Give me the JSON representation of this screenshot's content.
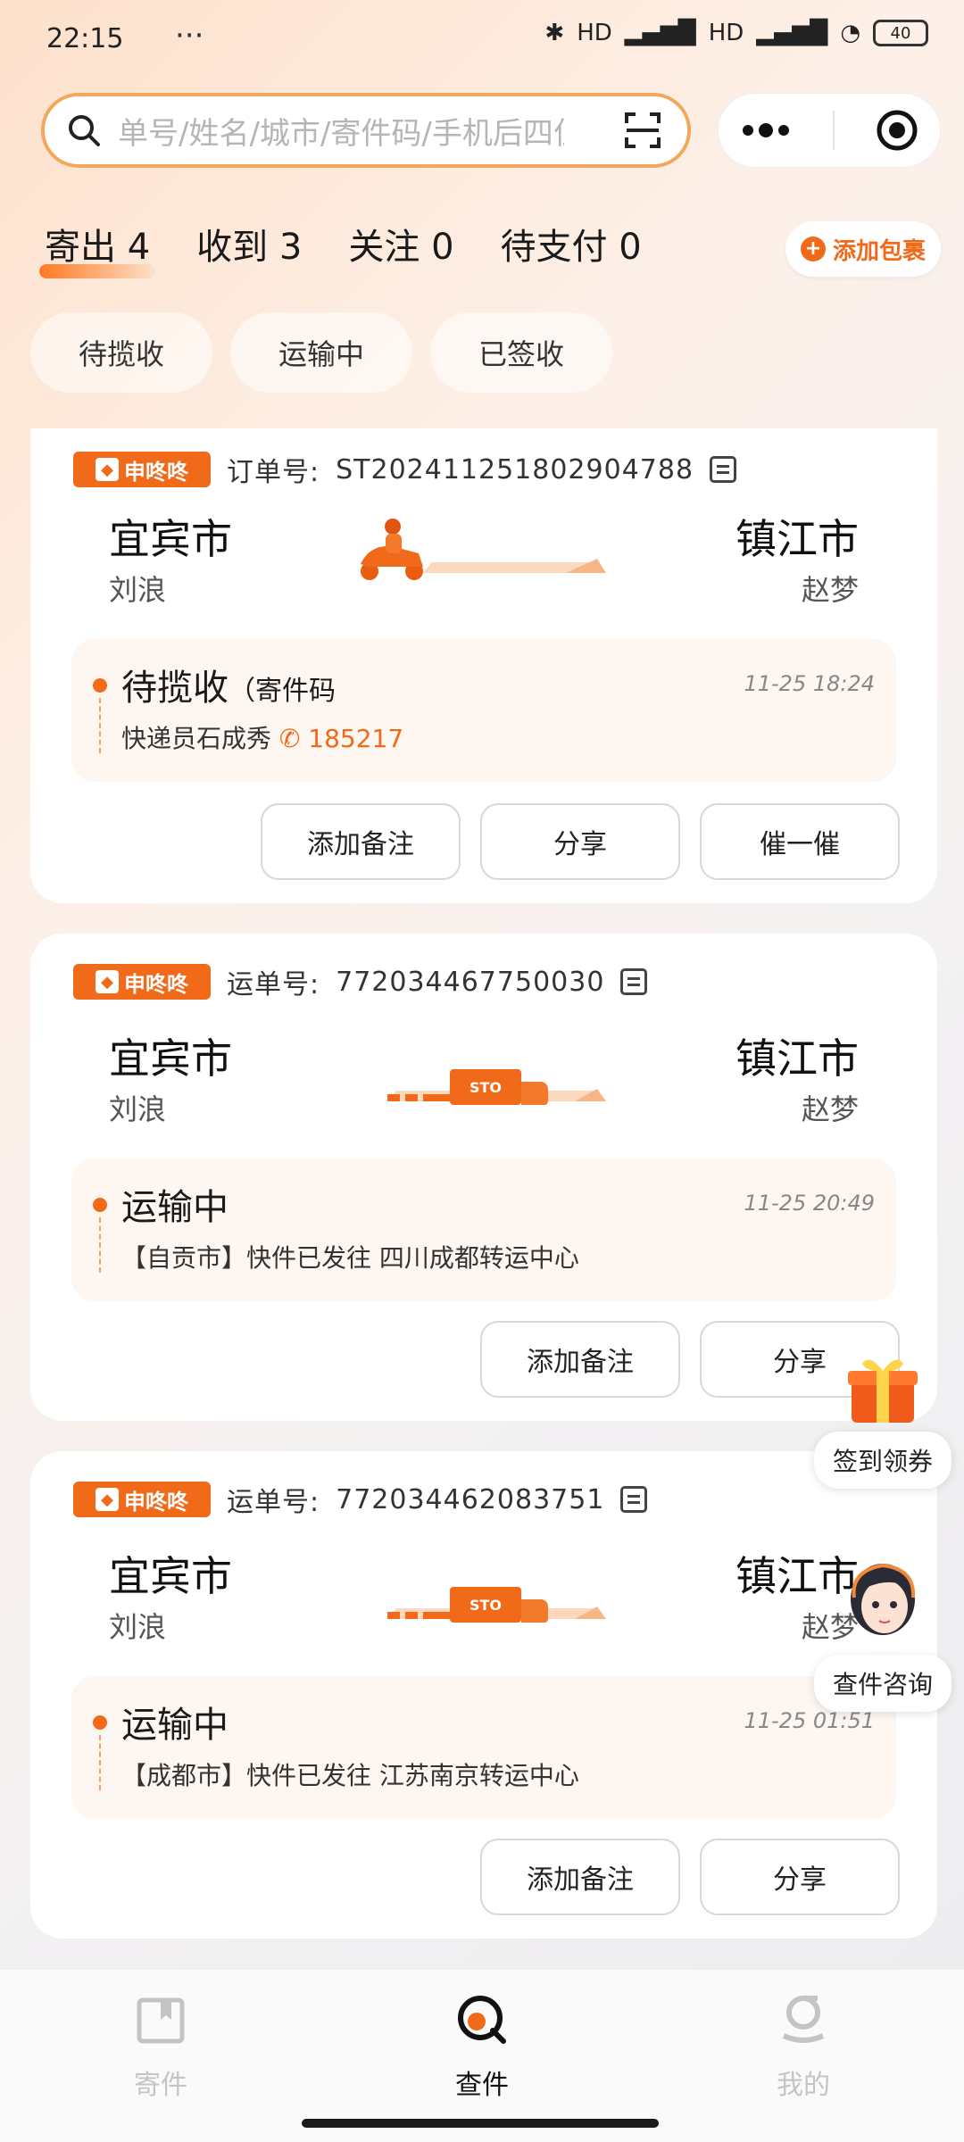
{
  "status_bar": {
    "time": "22:15",
    "dots": "···",
    "net1": "HD",
    "net2": "HD",
    "battery": "40"
  },
  "search": {
    "placeholder": "单号/姓名/城市/寄件码/手机后四位"
  },
  "stats": [
    {
      "label": "寄出",
      "count": "4"
    },
    {
      "label": "收到",
      "count": "3"
    },
    {
      "label": "关注",
      "count": "0"
    },
    {
      "label": "待支付",
      "count": "0"
    }
  ],
  "add_package": "添加包裹",
  "filter_tabs": [
    "待揽收",
    "运输中",
    "已签收"
  ],
  "cards": [
    {
      "brand": "申咚咚",
      "id_label": "订单号:",
      "id_value": "ST2024112518029047​88",
      "from_city": "宜宾市",
      "from_person": "刘浪",
      "to_city": "镇江市",
      "to_person": "赵梦",
      "status_title": "待揽收",
      "status_title_extra": "（寄件码",
      "status_sub_prefix": "快递员石成秀",
      "status_phone": "185217",
      "status_time": "11-25 18:24",
      "actions": [
        "添加备注",
        "分享",
        "催一催"
      ]
    },
    {
      "brand": "申咚咚",
      "id_label": "运单号:",
      "id_value": "772034467750030",
      "from_city": "宜宾市",
      "from_person": "刘浪",
      "to_city": "镇江市",
      "to_person": "赵梦",
      "status_title": "运输中",
      "status_sub": "【自贡市】快件已发往 四川成都转运中心",
      "status_time": "11-25 20:49",
      "actions": [
        "添加备注",
        "分享"
      ]
    },
    {
      "brand": "申咚咚",
      "id_label": "运单号:",
      "id_value": "772034462083751",
      "from_city": "宜宾市",
      "from_person": "刘浪",
      "to_city": "镇江市",
      "to_person": "赵梦",
      "status_title": "运输中",
      "status_sub": "【成都市】快件已发往 江苏南京转运中心",
      "status_time": "11-25 01:51",
      "actions": [
        "添加备注",
        "分享"
      ]
    }
  ],
  "truck_text": "STO",
  "floating": {
    "gift_label": "签到领券",
    "consult_label": "查件咨询"
  },
  "nav": [
    {
      "label": "寄件",
      "icon": "send-book-icon"
    },
    {
      "label": "查件",
      "icon": "search-q-icon"
    },
    {
      "label": "我的",
      "icon": "profile-g-icon"
    }
  ],
  "colors": {
    "accent": "#f06a1a",
    "search_border": "#f2a85a"
  }
}
